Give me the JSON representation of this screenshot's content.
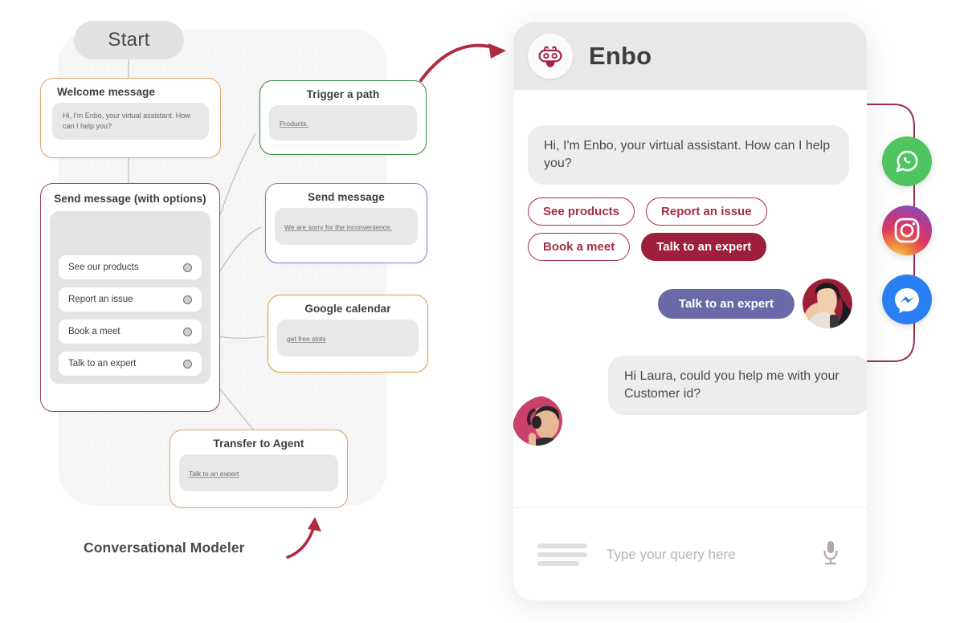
{
  "flow": {
    "caption": "Conversational Modeler",
    "start_label": "Start",
    "nodes": [
      {
        "id": "welcome-message",
        "title": "Welcome message",
        "body": "Hi, I'm Enbo, your virtual assistant. How can I help you?",
        "border_color": "#dca56b"
      },
      {
        "id": "trigger-a-path",
        "title": "Trigger a path",
        "body": "Products.",
        "border_color": "#2e8b3f"
      },
      {
        "id": "send-message",
        "title": "Send message",
        "body": "We are sorry for the inconvenience.",
        "border_color": "#7a80c4"
      },
      {
        "id": "google-calendar",
        "title": "Google calendar",
        "body": "get free slots",
        "border_color": "#e59a34"
      },
      {
        "id": "transfer-to-agent",
        "title": "Transfer to Agent",
        "body": "Talk to an expert",
        "border_color": "#dca56b"
      },
      {
        "id": "send-message-with-options",
        "title": "Send message (with options)",
        "border_color": "#9a4457",
        "options": [
          "See our products",
          "Report an issue",
          "Book a meet",
          "Talk to an expert"
        ]
      }
    ]
  },
  "chat": {
    "title": "Enbo",
    "bot_icon": "robot-icon",
    "messages": [
      {
        "sender": "bot",
        "text": "Hi, I'm Enbo, your virtual assistant. How can I help you?"
      },
      {
        "sender": "user",
        "text": "Talk to an expert"
      },
      {
        "sender": "agent",
        "text": "Hi Laura, could you help me with your Customer id?"
      }
    ],
    "quick_replies": [
      {
        "label": "See products",
        "style": "outline"
      },
      {
        "label": "Report an issue",
        "style": "outline"
      },
      {
        "label": "Book a meet",
        "style": "outline"
      },
      {
        "label": "Talk to an expert",
        "style": "solid"
      }
    ],
    "input": {
      "placeholder": "Type your query here",
      "value": "",
      "menu_icon": "hamburger-menu-icon",
      "mic_icon": "microphone-icon"
    },
    "colors": {
      "accent": "#a32e44",
      "accent_solid": "#9e1f39",
      "user_bubble": "#6a6aa8",
      "bubble_bg": "#ededed"
    }
  },
  "channels": [
    {
      "name": "WhatsApp",
      "icon": "whatsapp-icon",
      "color": "#4fc561"
    },
    {
      "name": "Instagram",
      "icon": "instagram-icon",
      "color": "#e0395b"
    },
    {
      "name": "Messenger",
      "icon": "messenger-icon",
      "color": "#2a7ff5"
    }
  ]
}
